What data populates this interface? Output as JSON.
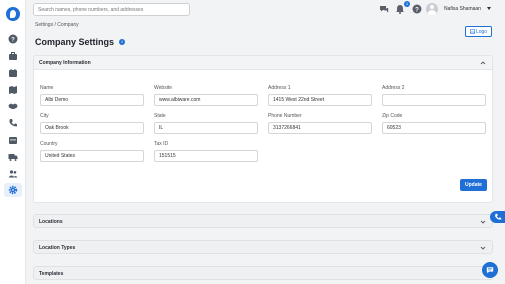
{
  "search": {
    "placeholder": "Search names, phone numbers, and addresses"
  },
  "header": {
    "user_name": "Nafisa Shamaan",
    "notification_count": "1"
  },
  "breadcrumb": "Settings / Company",
  "page": {
    "title": "Company Settings",
    "logo_button": "Logo"
  },
  "company_info": {
    "title": "Company Information",
    "fields": [
      {
        "label": "Name",
        "value": "Albi Demo"
      },
      {
        "label": "Website",
        "value": "www.albiware.com"
      },
      {
        "label": "Address 1",
        "value": "1415 West 22nd Street"
      },
      {
        "label": "Address 2",
        "value": ""
      },
      {
        "label": "City",
        "value": "Oak Brook"
      },
      {
        "label": "State",
        "value": "IL"
      },
      {
        "label": "Phone Number",
        "value": "3137266841"
      },
      {
        "label": "Zip Code",
        "value": "60523"
      },
      {
        "label": "Country",
        "value": "United States"
      },
      {
        "label": "Tax ID",
        "value": "151515"
      }
    ],
    "update_button": "Update"
  },
  "sections": [
    {
      "title": "Locations"
    },
    {
      "title": "Location Types"
    },
    {
      "title": "Templates"
    }
  ],
  "colors": {
    "accent": "#1f6fd6",
    "background": "#f2f3f5"
  },
  "sidebar_icons": [
    "help-icon",
    "briefcase-icon",
    "calendar-icon",
    "map-icon",
    "handshake-icon",
    "phone-icon",
    "calendar-grid-icon",
    "truck-icon",
    "users-icon",
    "gear-icon"
  ]
}
